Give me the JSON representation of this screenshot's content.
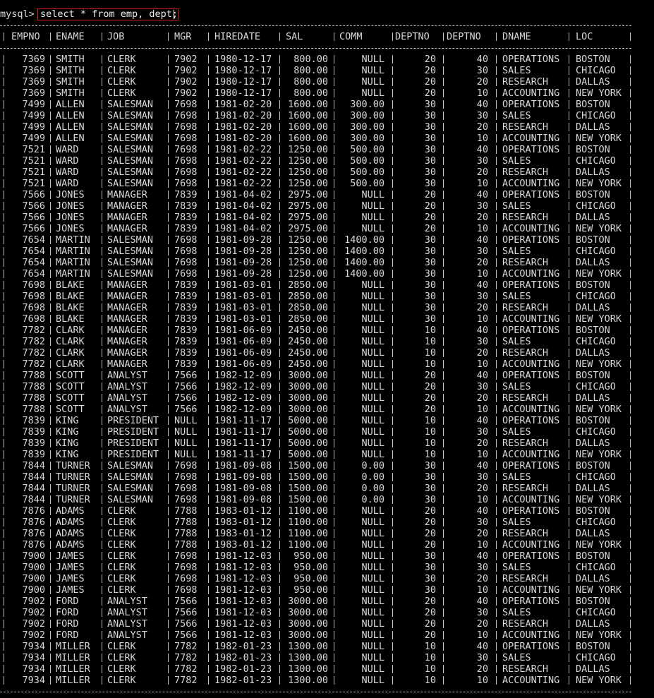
{
  "terminal": {
    "prompt": "mysql>",
    "command": "select * from emp, dept;"
  },
  "columns": [
    "EMPNO",
    "ENAME",
    "JOB",
    "MGR",
    "HIREDATE",
    "SAL",
    "COMM",
    "DEPTNO",
    "DEPTNO",
    "DNAME",
    "LOC"
  ],
  "rows": [
    [
      "7369",
      "SMITH",
      "CLERK",
      "7902",
      "1980-12-17",
      "800.00",
      "NULL",
      "20",
      "40",
      "OPERATIONS",
      "BOSTON"
    ],
    [
      "7369",
      "SMITH",
      "CLERK",
      "7902",
      "1980-12-17",
      "800.00",
      "NULL",
      "20",
      "30",
      "SALES",
      "CHICAGO"
    ],
    [
      "7369",
      "SMITH",
      "CLERK",
      "7902",
      "1980-12-17",
      "800.00",
      "NULL",
      "20",
      "20",
      "RESEARCH",
      "DALLAS"
    ],
    [
      "7369",
      "SMITH",
      "CLERK",
      "7902",
      "1980-12-17",
      "800.00",
      "NULL",
      "20",
      "10",
      "ACCOUNTING",
      "NEW YORK"
    ],
    [
      "7499",
      "ALLEN",
      "SALESMAN",
      "7698",
      "1981-02-20",
      "1600.00",
      "300.00",
      "30",
      "40",
      "OPERATIONS",
      "BOSTON"
    ],
    [
      "7499",
      "ALLEN",
      "SALESMAN",
      "7698",
      "1981-02-20",
      "1600.00",
      "300.00",
      "30",
      "30",
      "SALES",
      "CHICAGO"
    ],
    [
      "7499",
      "ALLEN",
      "SALESMAN",
      "7698",
      "1981-02-20",
      "1600.00",
      "300.00",
      "30",
      "20",
      "RESEARCH",
      "DALLAS"
    ],
    [
      "7499",
      "ALLEN",
      "SALESMAN",
      "7698",
      "1981-02-20",
      "1600.00",
      "300.00",
      "30",
      "10",
      "ACCOUNTING",
      "NEW YORK"
    ],
    [
      "7521",
      "WARD",
      "SALESMAN",
      "7698",
      "1981-02-22",
      "1250.00",
      "500.00",
      "30",
      "40",
      "OPERATIONS",
      "BOSTON"
    ],
    [
      "7521",
      "WARD",
      "SALESMAN",
      "7698",
      "1981-02-22",
      "1250.00",
      "500.00",
      "30",
      "30",
      "SALES",
      "CHICAGO"
    ],
    [
      "7521",
      "WARD",
      "SALESMAN",
      "7698",
      "1981-02-22",
      "1250.00",
      "500.00",
      "30",
      "20",
      "RESEARCH",
      "DALLAS"
    ],
    [
      "7521",
      "WARD",
      "SALESMAN",
      "7698",
      "1981-02-22",
      "1250.00",
      "500.00",
      "30",
      "10",
      "ACCOUNTING",
      "NEW YORK"
    ],
    [
      "7566",
      "JONES",
      "MANAGER",
      "7839",
      "1981-04-02",
      "2975.00",
      "NULL",
      "20",
      "40",
      "OPERATIONS",
      "BOSTON"
    ],
    [
      "7566",
      "JONES",
      "MANAGER",
      "7839",
      "1981-04-02",
      "2975.00",
      "NULL",
      "20",
      "30",
      "SALES",
      "CHICAGO"
    ],
    [
      "7566",
      "JONES",
      "MANAGER",
      "7839",
      "1981-04-02",
      "2975.00",
      "NULL",
      "20",
      "20",
      "RESEARCH",
      "DALLAS"
    ],
    [
      "7566",
      "JONES",
      "MANAGER",
      "7839",
      "1981-04-02",
      "2975.00",
      "NULL",
      "20",
      "10",
      "ACCOUNTING",
      "NEW YORK"
    ],
    [
      "7654",
      "MARTIN",
      "SALESMAN",
      "7698",
      "1981-09-28",
      "1250.00",
      "1400.00",
      "30",
      "40",
      "OPERATIONS",
      "BOSTON"
    ],
    [
      "7654",
      "MARTIN",
      "SALESMAN",
      "7698",
      "1981-09-28",
      "1250.00",
      "1400.00",
      "30",
      "30",
      "SALES",
      "CHICAGO"
    ],
    [
      "7654",
      "MARTIN",
      "SALESMAN",
      "7698",
      "1981-09-28",
      "1250.00",
      "1400.00",
      "30",
      "20",
      "RESEARCH",
      "DALLAS"
    ],
    [
      "7654",
      "MARTIN",
      "SALESMAN",
      "7698",
      "1981-09-28",
      "1250.00",
      "1400.00",
      "30",
      "10",
      "ACCOUNTING",
      "NEW YORK"
    ],
    [
      "7698",
      "BLAKE",
      "MANAGER",
      "7839",
      "1981-03-01",
      "2850.00",
      "NULL",
      "30",
      "40",
      "OPERATIONS",
      "BOSTON"
    ],
    [
      "7698",
      "BLAKE",
      "MANAGER",
      "7839",
      "1981-03-01",
      "2850.00",
      "NULL",
      "30",
      "30",
      "SALES",
      "CHICAGO"
    ],
    [
      "7698",
      "BLAKE",
      "MANAGER",
      "7839",
      "1981-03-01",
      "2850.00",
      "NULL",
      "30",
      "20",
      "RESEARCH",
      "DALLAS"
    ],
    [
      "7698",
      "BLAKE",
      "MANAGER",
      "7839",
      "1981-03-01",
      "2850.00",
      "NULL",
      "30",
      "10",
      "ACCOUNTING",
      "NEW YORK"
    ],
    [
      "7782",
      "CLARK",
      "MANAGER",
      "7839",
      "1981-06-09",
      "2450.00",
      "NULL",
      "10",
      "40",
      "OPERATIONS",
      "BOSTON"
    ],
    [
      "7782",
      "CLARK",
      "MANAGER",
      "7839",
      "1981-06-09",
      "2450.00",
      "NULL",
      "10",
      "30",
      "SALES",
      "CHICAGO"
    ],
    [
      "7782",
      "CLARK",
      "MANAGER",
      "7839",
      "1981-06-09",
      "2450.00",
      "NULL",
      "10",
      "20",
      "RESEARCH",
      "DALLAS"
    ],
    [
      "7782",
      "CLARK",
      "MANAGER",
      "7839",
      "1981-06-09",
      "2450.00",
      "NULL",
      "10",
      "10",
      "ACCOUNTING",
      "NEW YORK"
    ],
    [
      "7788",
      "SCOTT",
      "ANALYST",
      "7566",
      "1982-12-09",
      "3000.00",
      "NULL",
      "20",
      "40",
      "OPERATIONS",
      "BOSTON"
    ],
    [
      "7788",
      "SCOTT",
      "ANALYST",
      "7566",
      "1982-12-09",
      "3000.00",
      "NULL",
      "20",
      "30",
      "SALES",
      "CHICAGO"
    ],
    [
      "7788",
      "SCOTT",
      "ANALYST",
      "7566",
      "1982-12-09",
      "3000.00",
      "NULL",
      "20",
      "20",
      "RESEARCH",
      "DALLAS"
    ],
    [
      "7788",
      "SCOTT",
      "ANALYST",
      "7566",
      "1982-12-09",
      "3000.00",
      "NULL",
      "20",
      "10",
      "ACCOUNTING",
      "NEW YORK"
    ],
    [
      "7839",
      "KING",
      "PRESIDENT",
      "NULL",
      "1981-11-17",
      "5000.00",
      "NULL",
      "10",
      "40",
      "OPERATIONS",
      "BOSTON"
    ],
    [
      "7839",
      "KING",
      "PRESIDENT",
      "NULL",
      "1981-11-17",
      "5000.00",
      "NULL",
      "10",
      "30",
      "SALES",
      "CHICAGO"
    ],
    [
      "7839",
      "KING",
      "PRESIDENT",
      "NULL",
      "1981-11-17",
      "5000.00",
      "NULL",
      "10",
      "20",
      "RESEARCH",
      "DALLAS"
    ],
    [
      "7839",
      "KING",
      "PRESIDENT",
      "NULL",
      "1981-11-17",
      "5000.00",
      "NULL",
      "10",
      "10",
      "ACCOUNTING",
      "NEW YORK"
    ],
    [
      "7844",
      "TURNER",
      "SALESMAN",
      "7698",
      "1981-09-08",
      "1500.00",
      "0.00",
      "30",
      "40",
      "OPERATIONS",
      "BOSTON"
    ],
    [
      "7844",
      "TURNER",
      "SALESMAN",
      "7698",
      "1981-09-08",
      "1500.00",
      "0.00",
      "30",
      "30",
      "SALES",
      "CHICAGO"
    ],
    [
      "7844",
      "TURNER",
      "SALESMAN",
      "7698",
      "1981-09-08",
      "1500.00",
      "0.00",
      "30",
      "20",
      "RESEARCH",
      "DALLAS"
    ],
    [
      "7844",
      "TURNER",
      "SALESMAN",
      "7698",
      "1981-09-08",
      "1500.00",
      "0.00",
      "30",
      "10",
      "ACCOUNTING",
      "NEW YORK"
    ],
    [
      "7876",
      "ADAMS",
      "CLERK",
      "7788",
      "1983-01-12",
      "1100.00",
      "NULL",
      "20",
      "40",
      "OPERATIONS",
      "BOSTON"
    ],
    [
      "7876",
      "ADAMS",
      "CLERK",
      "7788",
      "1983-01-12",
      "1100.00",
      "NULL",
      "20",
      "30",
      "SALES",
      "CHICAGO"
    ],
    [
      "7876",
      "ADAMS",
      "CLERK",
      "7788",
      "1983-01-12",
      "1100.00",
      "NULL",
      "20",
      "20",
      "RESEARCH",
      "DALLAS"
    ],
    [
      "7876",
      "ADAMS",
      "CLERK",
      "7788",
      "1983-01-12",
      "1100.00",
      "NULL",
      "20",
      "10",
      "ACCOUNTING",
      "NEW YORK"
    ],
    [
      "7900",
      "JAMES",
      "CLERK",
      "7698",
      "1981-12-03",
      "950.00",
      "NULL",
      "30",
      "40",
      "OPERATIONS",
      "BOSTON"
    ],
    [
      "7900",
      "JAMES",
      "CLERK",
      "7698",
      "1981-12-03",
      "950.00",
      "NULL",
      "30",
      "30",
      "SALES",
      "CHICAGO"
    ],
    [
      "7900",
      "JAMES",
      "CLERK",
      "7698",
      "1981-12-03",
      "950.00",
      "NULL",
      "30",
      "20",
      "RESEARCH",
      "DALLAS"
    ],
    [
      "7900",
      "JAMES",
      "CLERK",
      "7698",
      "1981-12-03",
      "950.00",
      "NULL",
      "30",
      "10",
      "ACCOUNTING",
      "NEW YORK"
    ],
    [
      "7902",
      "FORD",
      "ANALYST",
      "7566",
      "1981-12-03",
      "3000.00",
      "NULL",
      "20",
      "40",
      "OPERATIONS",
      "BOSTON"
    ],
    [
      "7902",
      "FORD",
      "ANALYST",
      "7566",
      "1981-12-03",
      "3000.00",
      "NULL",
      "20",
      "30",
      "SALES",
      "CHICAGO"
    ],
    [
      "7902",
      "FORD",
      "ANALYST",
      "7566",
      "1981-12-03",
      "3000.00",
      "NULL",
      "20",
      "20",
      "RESEARCH",
      "DALLAS"
    ],
    [
      "7902",
      "FORD",
      "ANALYST",
      "7566",
      "1981-12-03",
      "3000.00",
      "NULL",
      "20",
      "10",
      "ACCOUNTING",
      "NEW YORK"
    ],
    [
      "7934",
      "MILLER",
      "CLERK",
      "7782",
      "1982-01-23",
      "1300.00",
      "NULL",
      "10",
      "40",
      "OPERATIONS",
      "BOSTON"
    ],
    [
      "7934",
      "MILLER",
      "CLERK",
      "7782",
      "1982-01-23",
      "1300.00",
      "NULL",
      "10",
      "30",
      "SALES",
      "CHICAGO"
    ],
    [
      "7934",
      "MILLER",
      "CLERK",
      "7782",
      "1982-01-23",
      "1300.00",
      "NULL",
      "10",
      "20",
      "RESEARCH",
      "DALLAS"
    ],
    [
      "7934",
      "MILLER",
      "CLERK",
      "7782",
      "1982-01-23",
      "1300.00",
      "NULL",
      "10",
      "10",
      "ACCOUNTING",
      "NEW YORK"
    ]
  ]
}
